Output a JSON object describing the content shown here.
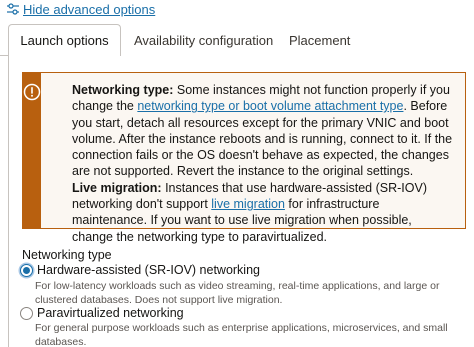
{
  "advanced_toggle": {
    "label": "Hide advanced options",
    "icon": "sliders-icon"
  },
  "tabs": [
    {
      "label": "Launch options",
      "active": true
    },
    {
      "label": "Availability configuration",
      "active": false
    },
    {
      "label": "Placement",
      "active": false
    }
  ],
  "warning": {
    "icon": "alert-circle-icon",
    "accent_color": "#b8600f",
    "networking_type_heading": "Networking type:",
    "networking_type_text_1": " Some instances might not function properly if you change the ",
    "networking_type_link": "networking type or boot volume attachment type",
    "networking_type_text_2": ". Before you start, detach all resources except for the primary VNIC and boot volume. After the instance reboots and is running, connect to it. If the connection fails or the OS doesn't behave as expected, the changes are not supported. Revert the instance to the original settings.",
    "live_migration_heading": "Live migration:",
    "live_migration_text_1": " Instances that use hardware-assisted (SR-IOV) networking don't support ",
    "live_migration_link": "live migration",
    "live_migration_text_2": " for infrastructure maintenance. If you want to use live migration when possible, change the networking type to paravirtualized."
  },
  "networking_type": {
    "label": "Networking type",
    "options": [
      {
        "label": "Hardware-assisted (SR-IOV) networking",
        "description": "For low-latency workloads such as video streaming, real-time applications, and large or clustered databases. Does not support live migration.",
        "selected": true
      },
      {
        "label": "Paravirtualized networking",
        "description": "For general purpose workloads such as enterprise applications, microservices, and small databases.",
        "selected": false
      }
    ]
  }
}
